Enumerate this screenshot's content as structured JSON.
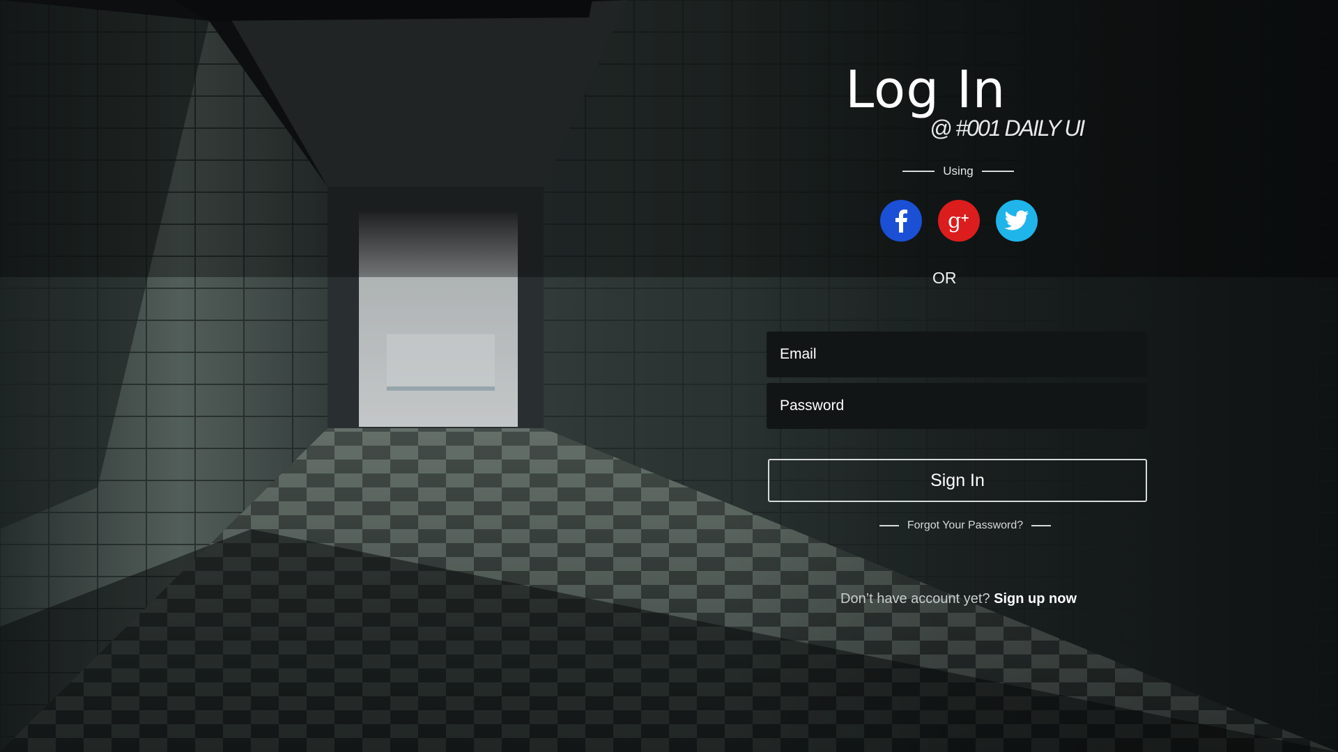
{
  "login": {
    "title": "Log In",
    "subtitle": "@ #001 DAILY UI",
    "using_label": "Using",
    "or_label": "OR",
    "email_placeholder": "Email",
    "password_placeholder": "Password",
    "signin_label": "Sign In",
    "forgot_label": "Forgot Your Password?",
    "signup_prompt": "Don’t have account yet?",
    "signup_link": "Sign up now"
  },
  "socials": [
    {
      "name": "Facebook",
      "icon": "facebook-icon",
      "color": "#1b4fd6"
    },
    {
      "name": "Google Plus",
      "icon": "google-plus-icon",
      "color": "#dc1d1d"
    },
    {
      "name": "Twitter",
      "icon": "twitter-icon",
      "color": "#1fb4ea"
    }
  ]
}
